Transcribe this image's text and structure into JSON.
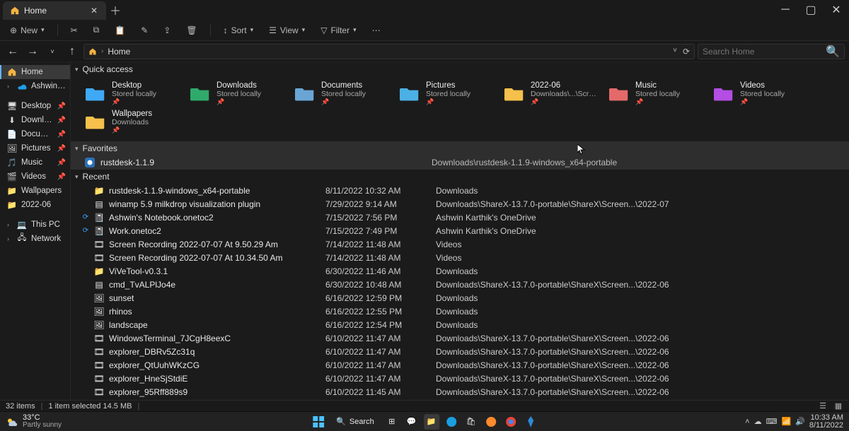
{
  "tab": {
    "title": "Home"
  },
  "toolbar": {
    "new": "New",
    "sort": "Sort",
    "view": "View",
    "filter": "Filter"
  },
  "breadcrumb": {
    "root": "Home"
  },
  "search": {
    "placeholder": "Search Home"
  },
  "sidebar": {
    "home": "Home",
    "personal": "Ashwin - Personal",
    "desktop": "Desktop",
    "downloads": "Downloads",
    "documents": "Documents",
    "pictures": "Pictures",
    "music": "Music",
    "videos": "Videos",
    "wallpapers": "Wallpapers",
    "folder202206": "2022-06",
    "thispc": "This PC",
    "network": "Network"
  },
  "sections": {
    "quick": "Quick access",
    "fav": "Favorites",
    "recent": "Recent"
  },
  "quick": [
    {
      "name": "Desktop",
      "sub": "Stored locally",
      "color": "#3fa9f5"
    },
    {
      "name": "Downloads",
      "sub": "Stored locally",
      "color": "#2faa6b"
    },
    {
      "name": "Documents",
      "sub": "Stored locally",
      "color": "#6aa5d6"
    },
    {
      "name": "Pictures",
      "sub": "Stored locally",
      "color": "#4cb0e4"
    },
    {
      "name": "2022-06",
      "sub": "Downloads\\...\\Screenshots",
      "color": "#f5c04b"
    },
    {
      "name": "Music",
      "sub": "Stored locally",
      "color": "#e46a6a"
    },
    {
      "name": "Videos",
      "sub": "Stored locally",
      "color": "#b44ee4"
    },
    {
      "name": "Wallpapers",
      "sub": "Downloads",
      "color": "#f5c04b"
    }
  ],
  "favorites": [
    {
      "name": "rustdesk-1.1.9",
      "path": "Downloads\\rustdesk-1.1.9-windows_x64-portable"
    }
  ],
  "recent": [
    {
      "icon": "folder",
      "name": "rustdesk-1.1.9-windows_x64-portable",
      "date": "8/11/2022 10:32 AM",
      "loc": "Downloads",
      "sync": ""
    },
    {
      "icon": "app",
      "name": "winamp 5.9 milkdrop visualization plugin",
      "date": "7/29/2022 9:14 AM",
      "loc": "Downloads\\ShareX-13.7.0-portable\\ShareX\\Screen...\\2022-07",
      "sync": ""
    },
    {
      "icon": "note",
      "name": "Ashwin's Notebook.onetoc2",
      "date": "7/15/2022 7:56 PM",
      "loc": "Ashwin Karthik's OneDrive",
      "sync": "⟳"
    },
    {
      "icon": "note",
      "name": "Work.onetoc2",
      "date": "7/15/2022 7:49 PM",
      "loc": "Ashwin Karthik's OneDrive",
      "sync": "⟳"
    },
    {
      "icon": "video",
      "name": "Screen Recording 2022-07-07 At 9.50.29 Am",
      "date": "7/14/2022 11:48 AM",
      "loc": "Videos",
      "sync": ""
    },
    {
      "icon": "video",
      "name": "Screen Recording 2022-07-07 At 10.34.50 Am",
      "date": "7/14/2022 11:48 AM",
      "loc": "Videos",
      "sync": ""
    },
    {
      "icon": "folder",
      "name": "ViVeTool-v0.3.1",
      "date": "6/30/2022 11:46 AM",
      "loc": "Downloads",
      "sync": ""
    },
    {
      "icon": "app",
      "name": "cmd_TvALPlJo4e",
      "date": "6/30/2022 10:48 AM",
      "loc": "Downloads\\ShareX-13.7.0-portable\\ShareX\\Screen...\\2022-06",
      "sync": ""
    },
    {
      "icon": "image",
      "name": "sunset",
      "date": "6/16/2022 12:59 PM",
      "loc": "Downloads",
      "sync": ""
    },
    {
      "icon": "image",
      "name": "rhinos",
      "date": "6/16/2022 12:55 PM",
      "loc": "Downloads",
      "sync": ""
    },
    {
      "icon": "image",
      "name": "landscape",
      "date": "6/16/2022 12:54 PM",
      "loc": "Downloads",
      "sync": ""
    },
    {
      "icon": "video",
      "name": "WindowsTerminal_7JCgH8eexC",
      "date": "6/10/2022 11:47 AM",
      "loc": "Downloads\\ShareX-13.7.0-portable\\ShareX\\Screen...\\2022-06",
      "sync": ""
    },
    {
      "icon": "video",
      "name": "explorer_DBRv5Zc31q",
      "date": "6/10/2022 11:47 AM",
      "loc": "Downloads\\ShareX-13.7.0-portable\\ShareX\\Screen...\\2022-06",
      "sync": ""
    },
    {
      "icon": "video",
      "name": "explorer_QtUuhWKzCG",
      "date": "6/10/2022 11:47 AM",
      "loc": "Downloads\\ShareX-13.7.0-portable\\ShareX\\Screen...\\2022-06",
      "sync": ""
    },
    {
      "icon": "video",
      "name": "explorer_HneSjStdiE",
      "date": "6/10/2022 11:47 AM",
      "loc": "Downloads\\ShareX-13.7.0-portable\\ShareX\\Screen...\\2022-06",
      "sync": ""
    },
    {
      "icon": "video",
      "name": "explorer_95Rff889s9",
      "date": "6/10/2022 11:45 AM",
      "loc": "Downloads\\ShareX-13.7.0-portable\\ShareX\\Screen...\\2022-06",
      "sync": ""
    }
  ],
  "status": {
    "count": "32 items",
    "sel": "1 item selected  14.5 MB"
  },
  "taskbar": {
    "temp": "33°C",
    "weather": "Partly sunny",
    "search": "Search",
    "time": "10:33 AM",
    "date": "8/11/2022"
  }
}
